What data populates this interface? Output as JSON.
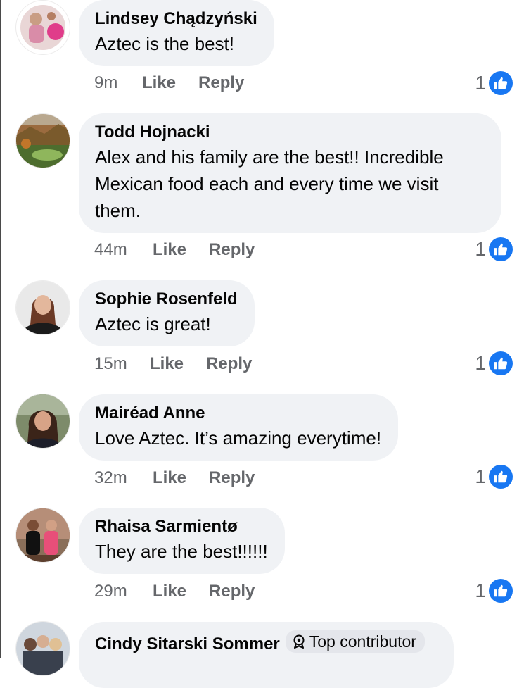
{
  "comments": [
    {
      "author": "Lindsey Chądzyński",
      "text": "Aztec is the best!",
      "time": "9m",
      "like_label": "Like",
      "reply_label": "Reply",
      "reaction_count": "1"
    },
    {
      "author": "Todd Hojnacki",
      "text": "Alex and his family are the best!! Incredible Mexican food each and every time we visit them.",
      "time": "44m",
      "like_label": "Like",
      "reply_label": "Reply",
      "reaction_count": "1"
    },
    {
      "author": "Sophie Rosenfeld",
      "text": "Aztec is great!",
      "time": "15m",
      "like_label": "Like",
      "reply_label": "Reply",
      "reaction_count": "1"
    },
    {
      "author": "Mairéad Anne",
      "text": "Love Aztec. It’s amazing everytime!",
      "time": "32m",
      "like_label": "Like",
      "reply_label": "Reply",
      "reaction_count": "1"
    },
    {
      "author": "Rhaisa Sarmientø",
      "text": "They are the best!!!!!!",
      "time": "29m",
      "like_label": "Like",
      "reply_label": "Reply",
      "reaction_count": "1"
    },
    {
      "author": "Cindy Sitarski Sommer",
      "badge": "Top contributor"
    }
  ],
  "colors": {
    "bubble": "#f0f2f5",
    "meta": "#65676b",
    "like_blue": "#1877f2"
  },
  "icons": {
    "reaction": "thumbs-up-icon",
    "badge": "top-contributor-icon"
  }
}
